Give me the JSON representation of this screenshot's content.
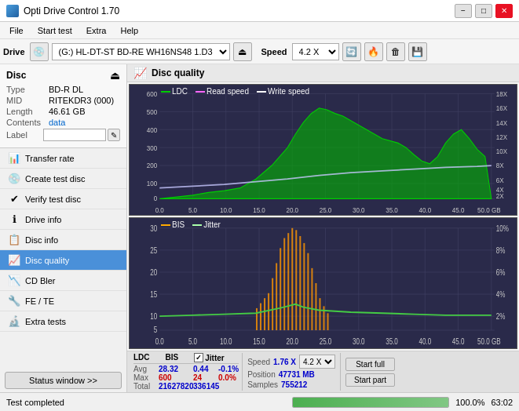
{
  "app": {
    "title": "Opti Drive Control 1.70",
    "icon": "disc-icon"
  },
  "titlebar": {
    "minimize": "−",
    "maximize": "□",
    "close": "✕"
  },
  "menu": {
    "items": [
      "File",
      "Start test",
      "Extra",
      "Help"
    ]
  },
  "toolbar": {
    "drive_label": "Drive",
    "drive_value": "(G:)  HL-DT-ST BD-RE  WH16NS48 1.D3",
    "speed_label": "Speed",
    "speed_value": "4.2 X"
  },
  "disc": {
    "section_label": "Disc",
    "type_label": "Type",
    "type_value": "BD-R DL",
    "mid_label": "MID",
    "mid_value": "RITEKDR3 (000)",
    "length_label": "Length",
    "length_value": "46.61 GB",
    "contents_label": "Contents",
    "contents_value": "data",
    "label_label": "Label",
    "label_value": ""
  },
  "nav": {
    "items": [
      {
        "id": "transfer-rate",
        "label": "Transfer rate",
        "icon": "📊"
      },
      {
        "id": "create-test-disc",
        "label": "Create test disc",
        "icon": "💿"
      },
      {
        "id": "verify-test-disc",
        "label": "Verify test disc",
        "icon": "✔"
      },
      {
        "id": "drive-info",
        "label": "Drive info",
        "icon": "ℹ"
      },
      {
        "id": "disc-info",
        "label": "Disc info",
        "icon": "📋"
      },
      {
        "id": "disc-quality",
        "label": "Disc quality",
        "icon": "📈",
        "active": true
      },
      {
        "id": "cd-bler",
        "label": "CD Bler",
        "icon": "📉"
      },
      {
        "id": "fe-te",
        "label": "FE / TE",
        "icon": "🔧"
      },
      {
        "id": "extra-tests",
        "label": "Extra tests",
        "icon": "🔬"
      }
    ],
    "status_button": "Status window >>"
  },
  "chart": {
    "title": "Disc quality",
    "upper": {
      "legend": [
        {
          "label": "LDC",
          "color": "#00cc00"
        },
        {
          "label": "Read speed",
          "color": "#ff66ff"
        },
        {
          "label": "Write speed",
          "color": "#ffffff"
        }
      ],
      "y_ticks_left": [
        "600",
        "500",
        "400",
        "300",
        "200",
        "100",
        "0"
      ],
      "y_ticks_right": [
        "18X",
        "16X",
        "14X",
        "12X",
        "10X",
        "8X",
        "6X",
        "4X",
        "2X"
      ],
      "x_ticks": [
        "0.0",
        "5.0",
        "10.0",
        "15.0",
        "20.0",
        "25.0",
        "30.0",
        "35.0",
        "40.0",
        "45.0",
        "50.0 GB"
      ]
    },
    "lower": {
      "legend": [
        {
          "label": "BIS",
          "color": "#ffaa00"
        },
        {
          "label": "Jitter",
          "color": "#ffffff"
        }
      ],
      "y_ticks_left": [
        "30",
        "25",
        "20",
        "15",
        "10",
        "5"
      ],
      "y_ticks_right": [
        "10%",
        "8%",
        "6%",
        "4%",
        "2%"
      ],
      "x_ticks": [
        "0.0",
        "5.0",
        "10.0",
        "15.0",
        "20.0",
        "25.0",
        "30.0",
        "35.0",
        "40.0",
        "45.0",
        "50.0 GB"
      ]
    }
  },
  "stats": {
    "ldc_label": "LDC",
    "bis_label": "BIS",
    "jitter_label": "Jitter",
    "jitter_checked": true,
    "speed_label": "Speed",
    "speed_value": "1.76 X",
    "speed_select": "4.2 X",
    "position_label": "Position",
    "position_value": "47731 MB",
    "samples_label": "Samples",
    "samples_value": "755212",
    "avg_label": "Avg",
    "avg_ldc": "28.32",
    "avg_bis": "0.44",
    "avg_jitter": "-0.1%",
    "max_label": "Max",
    "max_ldc": "600",
    "max_bis": "24",
    "max_jitter": "0.0%",
    "total_label": "Total",
    "total_ldc": "21627820",
    "total_bis": "336145",
    "start_full": "Start full",
    "start_part": "Start part"
  },
  "statusbar": {
    "text": "Test completed",
    "progress": 100,
    "progress_label": "100.0%",
    "time": "63:02"
  }
}
